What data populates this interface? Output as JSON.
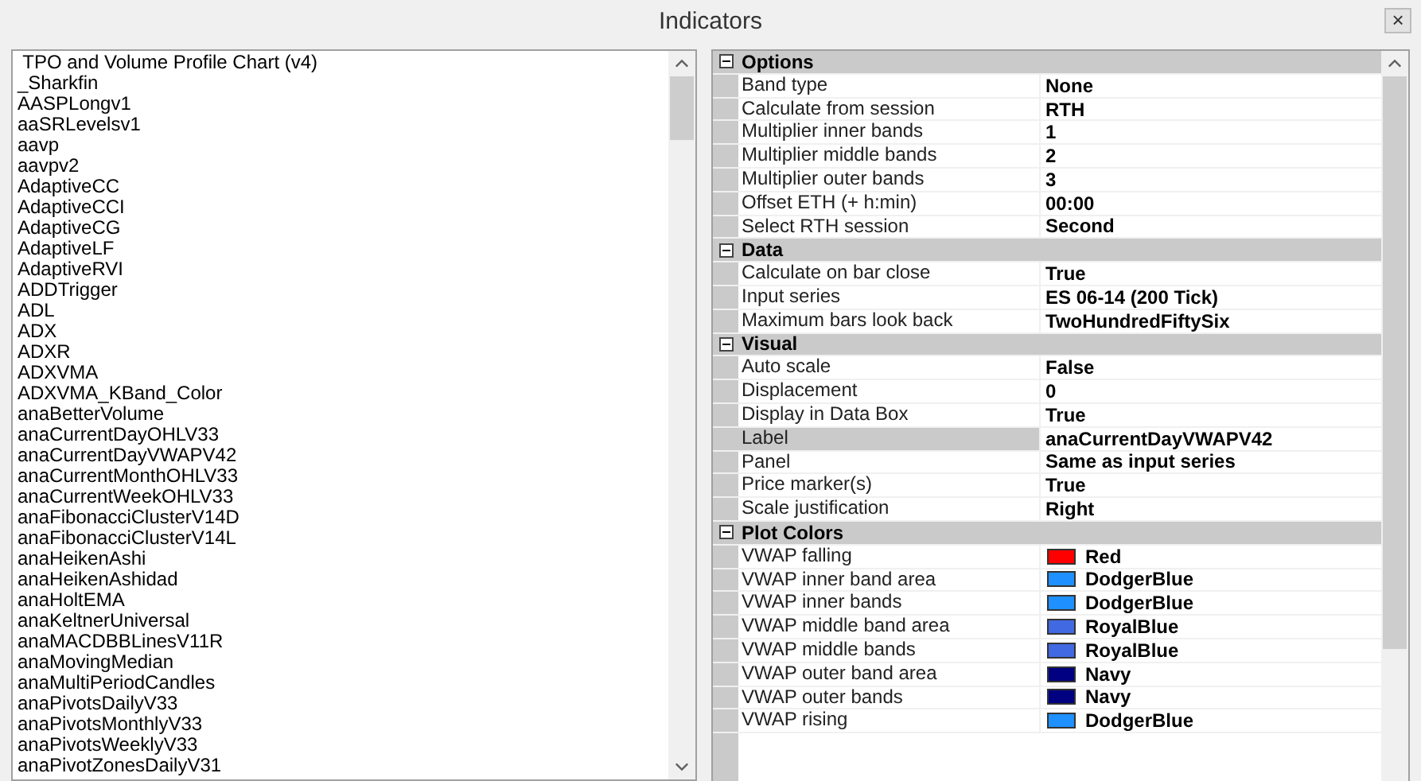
{
  "window": {
    "title": "Indicators",
    "close": "×"
  },
  "indicator_list": {
    "items": [
      " TPO and Volume Profile Chart (v4)",
      "_Sharkfin",
      "AASPLongv1",
      "aaSRLevelsv1",
      "aavp",
      "aavpv2",
      "AdaptiveCC",
      "AdaptiveCCI",
      "AdaptiveCG",
      "AdaptiveLF",
      "AdaptiveRVI",
      "ADDTrigger",
      "ADL",
      "ADX",
      "ADXR",
      "ADXVMA",
      "ADXVMA_KBand_Color",
      "anaBetterVolume",
      "anaCurrentDayOHLV33",
      "anaCurrentDayVWAPV42",
      "anaCurrentMonthOHLV33",
      "anaCurrentWeekOHLV33",
      "anaFibonacciClusterV14D",
      "anaFibonacciClusterV14L",
      "anaHeikenAshi",
      "anaHeikenAshidad",
      "anaHoltEMA",
      "anaKeltnerUniversal",
      "anaMACDBBLinesV11R",
      "anaMovingMedian",
      "anaMultiPeriodCandles",
      "anaPivotsDailyV33",
      "anaPivotsMonthlyV33",
      "anaPivotsWeeklyV33",
      "anaPivotZonesDailyV31"
    ]
  },
  "properties": {
    "categories": [
      {
        "name": "Options",
        "expanded": true,
        "rows": [
          {
            "label": "Band type",
            "value": "None",
            "selected": false
          },
          {
            "label": "Calculate from session",
            "value": "RTH",
            "selected": false
          },
          {
            "label": "Multiplier inner bands",
            "value": "1",
            "selected": false
          },
          {
            "label": "Multiplier middle bands",
            "value": "2",
            "selected": false
          },
          {
            "label": "Multiplier outer bands",
            "value": "3",
            "selected": false
          },
          {
            "label": "Offset ETH (+ h:min)",
            "value": "00:00",
            "selected": false
          },
          {
            "label": "Select RTH session",
            "value": "Second",
            "selected": false
          }
        ]
      },
      {
        "name": "Data",
        "expanded": true,
        "rows": [
          {
            "label": "Calculate on bar close",
            "value": "True",
            "selected": false
          },
          {
            "label": "Input series",
            "value": "ES 06-14 (200 Tick)",
            "selected": false
          },
          {
            "label": "Maximum bars look back",
            "value": "TwoHundredFiftySix",
            "selected": false
          }
        ]
      },
      {
        "name": "Visual",
        "expanded": true,
        "rows": [
          {
            "label": "Auto scale",
            "value": "False",
            "selected": false
          },
          {
            "label": "Displacement",
            "value": "0",
            "selected": false
          },
          {
            "label": "Display in Data Box",
            "value": "True",
            "selected": false
          },
          {
            "label": "Label",
            "value": "anaCurrentDayVWAPV42",
            "selected": true
          },
          {
            "label": "Panel",
            "value": "Same as input series",
            "selected": false
          },
          {
            "label": "Price marker(s)",
            "value": "True",
            "selected": false
          },
          {
            "label": "Scale justification",
            "value": "Right",
            "selected": false
          }
        ]
      },
      {
        "name": "Plot Colors",
        "expanded": true,
        "rows": [
          {
            "label": "VWAP falling",
            "value": "Red",
            "selected": false,
            "color": "#ff0000"
          },
          {
            "label": "VWAP inner band area",
            "value": "DodgerBlue",
            "selected": false,
            "color": "#1e90ff"
          },
          {
            "label": "VWAP inner bands",
            "value": "DodgerBlue",
            "selected": false,
            "color": "#1e90ff"
          },
          {
            "label": "VWAP middle band area",
            "value": "RoyalBlue",
            "selected": false,
            "color": "#4169e1"
          },
          {
            "label": "VWAP middle bands",
            "value": "RoyalBlue",
            "selected": false,
            "color": "#4169e1"
          },
          {
            "label": "VWAP outer band area",
            "value": "Navy",
            "selected": false,
            "color": "#000080"
          },
          {
            "label": "VWAP outer bands",
            "value": "Navy",
            "selected": false,
            "color": "#000080"
          },
          {
            "label": "VWAP rising",
            "value": "DodgerBlue",
            "selected": false,
            "color": "#1e90ff"
          }
        ]
      }
    ]
  }
}
